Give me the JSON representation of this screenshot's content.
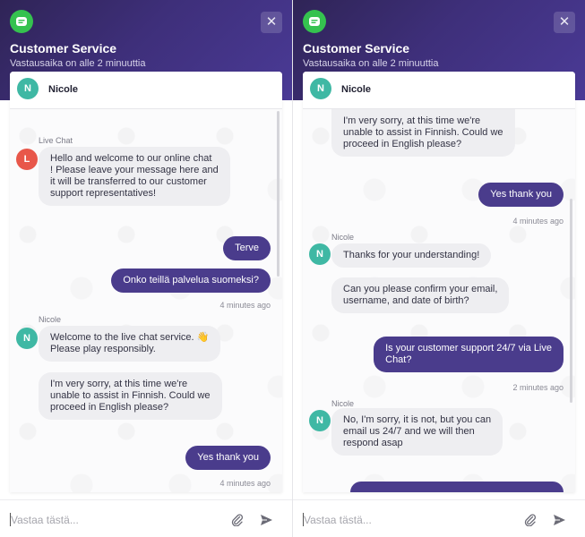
{
  "header": {
    "title": "Customer Service",
    "subtitle": "Vastausaika on alle 2 minuuttia",
    "close_label": "✕"
  },
  "agent": {
    "name": "Nicole",
    "initial": "N"
  },
  "bot": {
    "name": "Live Chat",
    "initial": "L"
  },
  "composer": {
    "placeholder": "Vastaa tästä..."
  },
  "colors": {
    "header_bg": "#3e2f7a",
    "outgoing_bubble": "#4a3c8c",
    "incoming_bubble": "#eeeef1",
    "avatar_nicole": "#3fb8a4",
    "avatar_live_chat": "#e8574a",
    "logo": "#35c24f"
  },
  "icons": {
    "logo": "chat-logo-icon",
    "close": "close-icon",
    "attach": "paperclip-icon",
    "send": "send-icon"
  },
  "left": {
    "live_chat_sender": "Live Chat",
    "welcome_msg": "Hello and welcome to our online chat\n! Please leave your message here and\nit will be transferred to our customer\nsupport representatives!",
    "terve": "Terve",
    "onko": "Onko teillä palvelua suomeksi?",
    "time1": "4 minutes ago",
    "nicole_sender": "Nicole",
    "welcome_live": "Welcome to the live chat service. 👋\nPlease play responsibly.",
    "sorry": "I'm very sorry, at this time we're\nunable to assist in Finnish. Could we\nproceed in English please?",
    "yes": "Yes thank you",
    "time2": "4 minutes ago"
  },
  "right": {
    "sorry": "I'm very sorry, at this time we're\nunable to assist in Finnish. Could we\nproceed in English please?",
    "yes": "Yes thank you",
    "time1": "4 minutes ago",
    "nicole_sender1": "Nicole",
    "thanks": "Thanks for your understanding!",
    "confirm": "Can you please confirm your email,\nusername, and date of birth?",
    "q247": "Is your customer support 24/7 via Live\nChat?",
    "time2": "2 minutes ago",
    "nicole_sender2": "Nicole",
    "no": "No, I'm sorry, it is not, but you can\nemail us 24/7 and we will then\nrespond asap"
  }
}
